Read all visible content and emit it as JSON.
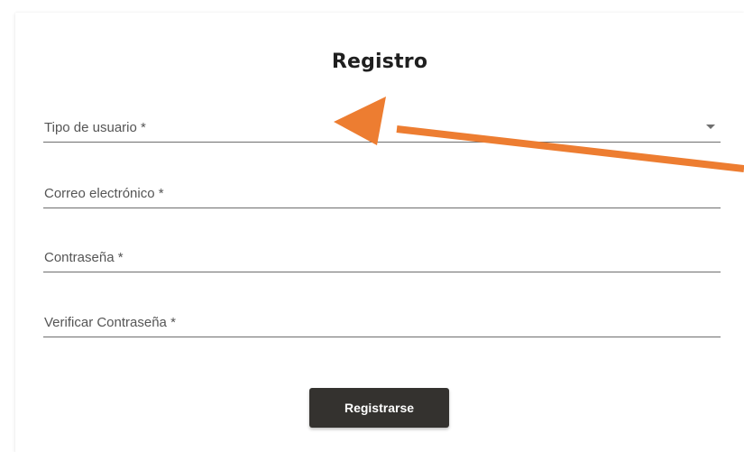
{
  "form": {
    "title": "Registro",
    "fields": [
      {
        "label": "Tipo de usuario *",
        "type": "select"
      },
      {
        "label": "Correo electrónico *",
        "type": "text"
      },
      {
        "label": "Contraseña *",
        "type": "password"
      },
      {
        "label": "Verificar Contraseña *",
        "type": "password"
      }
    ],
    "submit_label": "Registrarse"
  },
  "annotation": {
    "arrow_color": "#ed7d31",
    "arrow_icon": "orange-arrow-icon"
  }
}
